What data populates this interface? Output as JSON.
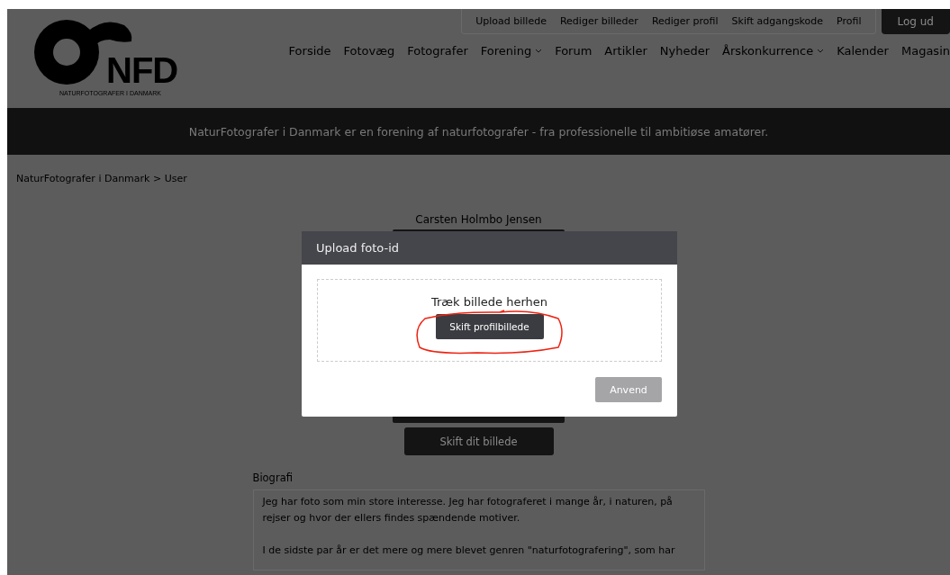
{
  "logo": {
    "initials": "NFD",
    "subtitle": "NATURFOTOGRAFER I DANMARK"
  },
  "user_links": [
    "Upload billede",
    "Rediger billeder",
    "Rediger profil",
    "Skift adgangskode",
    "Profil"
  ],
  "logout": "Log ud",
  "nav": [
    {
      "label": "Forside",
      "dropdown": false
    },
    {
      "label": "Fotovæg",
      "dropdown": false
    },
    {
      "label": "Fotografer",
      "dropdown": false
    },
    {
      "label": "Forening",
      "dropdown": true
    },
    {
      "label": "Forum",
      "dropdown": false
    },
    {
      "label": "Artikler",
      "dropdown": false
    },
    {
      "label": "Nyheder",
      "dropdown": false
    },
    {
      "label": "Årskonkurrence",
      "dropdown": true
    },
    {
      "label": "Kalender",
      "dropdown": false
    },
    {
      "label": "Magasin",
      "dropdown": false
    }
  ],
  "tagline": "NaturFotografer i Danmark er en forening af naturfotografer - fra professionelle til ambitiøse amatører.",
  "breadcrumb": "NaturFotografer i Danmark > User",
  "profile": {
    "name": "Carsten Holmbo Jensen",
    "change_photo_button": "Skift dit billede",
    "bio_label": "Biografi",
    "bio": "Jeg har foto som min store interesse. Jeg har fotograferet i mange år, i naturen, på rejser og hvor der ellers findes spændende motiver.\n\nI de sidste par år er det mere og mere blevet genren \"naturfotografering\", som har"
  },
  "modal": {
    "title": "Upload foto-id",
    "drop_hint": "Træk billede herhen",
    "choose_button": "Skift profilbillede",
    "apply_button": {
      "label": "Anvend",
      "disabled": true
    },
    "annotation_circle": true
  }
}
